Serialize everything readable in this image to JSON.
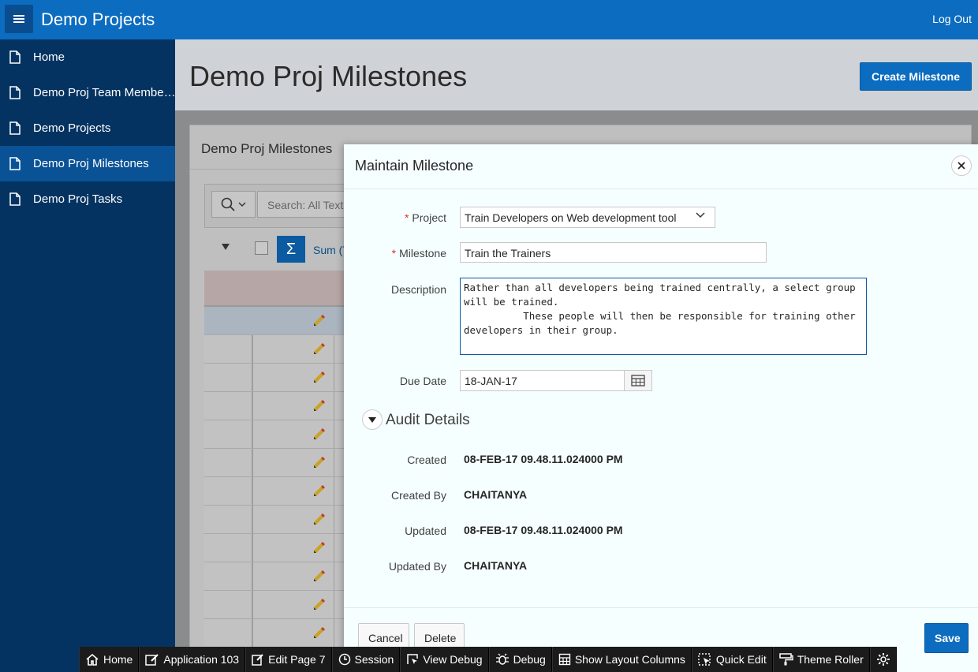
{
  "header": {
    "app_title": "Demo Projects",
    "logout_label": "Log Out"
  },
  "sidebar": {
    "items": [
      {
        "label": "Home",
        "active": false
      },
      {
        "label": "Demo Proj Team Membe…",
        "active": false
      },
      {
        "label": "Demo Projects",
        "active": false
      },
      {
        "label": "Demo Proj Milestones",
        "active": true
      },
      {
        "label": "Demo Proj Tasks",
        "active": false
      }
    ]
  },
  "page": {
    "title": "Demo Proj Milestones",
    "create_button": "Create Milestone"
  },
  "report": {
    "title": "Demo Proj Milestones",
    "search_placeholder": "Search: All Text C",
    "sum_label": "Sum (T"
  },
  "dialog": {
    "title": "Maintain Milestone",
    "fields": {
      "project_label": "Project",
      "project_value": "Train Developers on Web development tool",
      "milestone_label": "Milestone",
      "milestone_value": "Train the Trainers",
      "description_label": "Description",
      "description_value": "Rather than all developers being trained centrally, a select group\nwill be trained.\n          These people will then be responsible for training other\ndevelopers in their group.",
      "due_date_label": "Due Date",
      "due_date_value": "18-JAN-17"
    },
    "audit": {
      "title": "Audit Details",
      "created_label": "Created",
      "created_value": "08-FEB-17 09.48.11.024000 PM",
      "created_by_label": "Created By",
      "created_by_value": "CHAITANYA",
      "updated_label": "Updated",
      "updated_value": "08-FEB-17 09.48.11.024000 PM",
      "updated_by_label": "Updated By",
      "updated_by_value": "CHAITANYA"
    },
    "buttons": {
      "cancel": "Cancel",
      "delete": "Delete",
      "save": "Save"
    }
  },
  "devbar": {
    "home": "Home",
    "application": "Application 103",
    "edit_page": "Edit Page 7",
    "session": "Session",
    "view_debug": "View Debug",
    "debug": "Debug",
    "layout_columns": "Show Layout Columns",
    "quick_edit": "Quick Edit",
    "theme_roller": "Theme Roller"
  },
  "colors": {
    "header": "#0c6cc0",
    "sidebar": "#053361",
    "sidebar_active": "#0a5296",
    "primary_button": "#0c6cc0",
    "required": "#e0342a"
  }
}
